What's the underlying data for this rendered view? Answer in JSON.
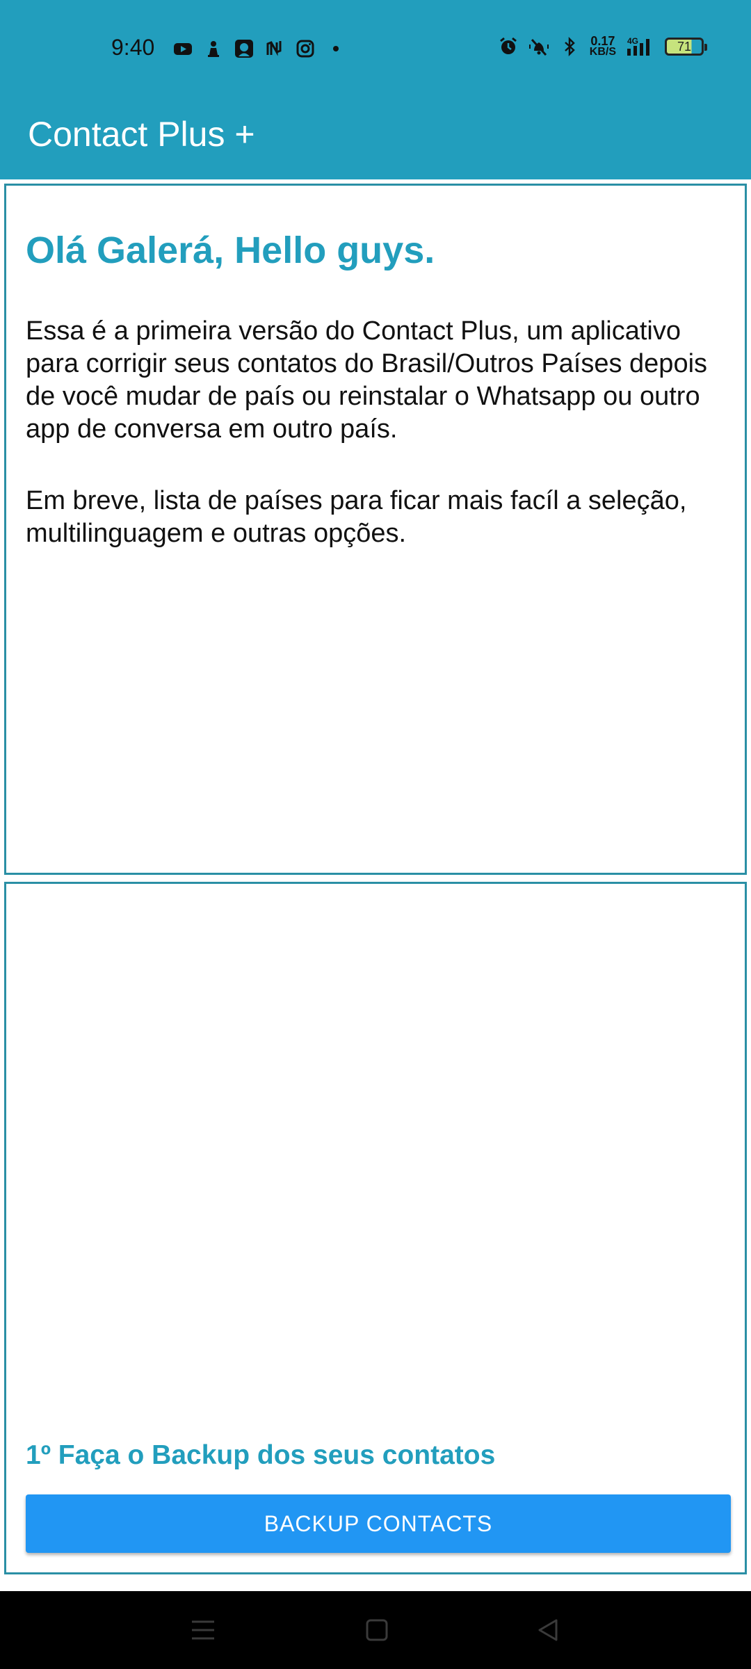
{
  "status_bar": {
    "time": "9:40",
    "left_icons": [
      "youtube-icon",
      "chess-pawn-icon",
      "avatar-app-icon",
      "notion-icon",
      "instagram-icon",
      "dot-icon"
    ],
    "right_icons": [
      "alarm-icon",
      "vibrate-off-icon",
      "bluetooth-icon"
    ],
    "net_speed_value": "0.17",
    "net_speed_unit": "KB/S",
    "network": "4G",
    "battery_level": "71"
  },
  "app_bar": {
    "title": "Contact Plus +"
  },
  "intro_card": {
    "greeting": "Olá Galerá, Hello guys.",
    "paragraph1": "Essa é a primeira versão do Contact Plus, um aplicativo para corrigir seus contatos do Brasil/Outros Países depois de você mudar de país ou reinstalar o Whatsapp ou outro app de conversa em outro país.",
    "paragraph2": "Em breve, lista de países para ficar mais facíl a seleção, multilinguagem e outras opções."
  },
  "backup_card": {
    "hint": "1º Faça o Backup dos seus contatos",
    "button_label": "BACKUP CONTACTS"
  },
  "colors": {
    "primary": "#229ebd",
    "button": "#2196f3",
    "card_border": "#2a8fa5"
  }
}
